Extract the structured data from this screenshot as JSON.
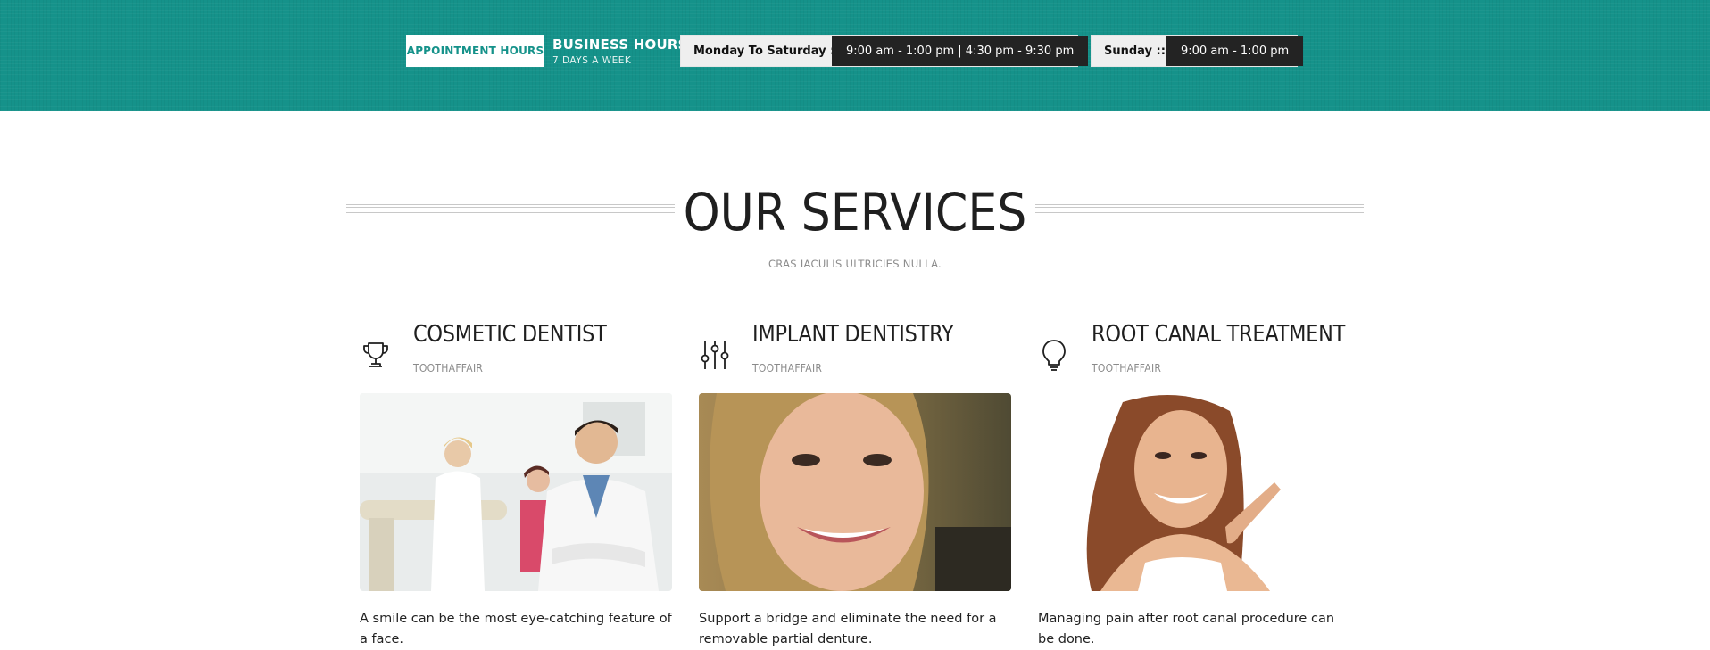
{
  "top_bar": {
    "appointment_label": "APPOINTMENT HOURS",
    "business_hours_title": "BUSINESS HOURS",
    "business_hours_sub": "7 DAYS A WEEK",
    "schedule": [
      {
        "day": "Monday To Saturday ::",
        "time": "9:00 am - 1:00 pm | 4:30 pm - 9:30 pm"
      },
      {
        "day": "Sunday ::",
        "time": "9:00 am - 1:00 pm"
      }
    ],
    "accent_color": "#15928a"
  },
  "services_section": {
    "title": "OUR SERVICES",
    "subtitle": "CRAS IACULIS ULTRICIES NULLA.",
    "cards": [
      {
        "icon": "trophy-icon",
        "title": "COSMETIC DENTIST",
        "tag": "TOOTHAFFAIR",
        "image": "dentist-team-photo",
        "text": "A smile can be the most eye-catching feature of a face."
      },
      {
        "icon": "sliders-icon",
        "title": "IMPLANT DENTISTRY",
        "tag": "TOOTHAFFAIR",
        "image": "smiling-woman-photo",
        "text": "Support a bridge and eliminate the need for a removable partial denture."
      },
      {
        "icon": "lightbulb-icon",
        "title": "ROOT CANAL TREATMENT",
        "tag": "TOOTHAFFAIR",
        "image": "woman-pointing-smile-photo",
        "text": "Managing pain after root canal procedure can be done."
      }
    ]
  }
}
